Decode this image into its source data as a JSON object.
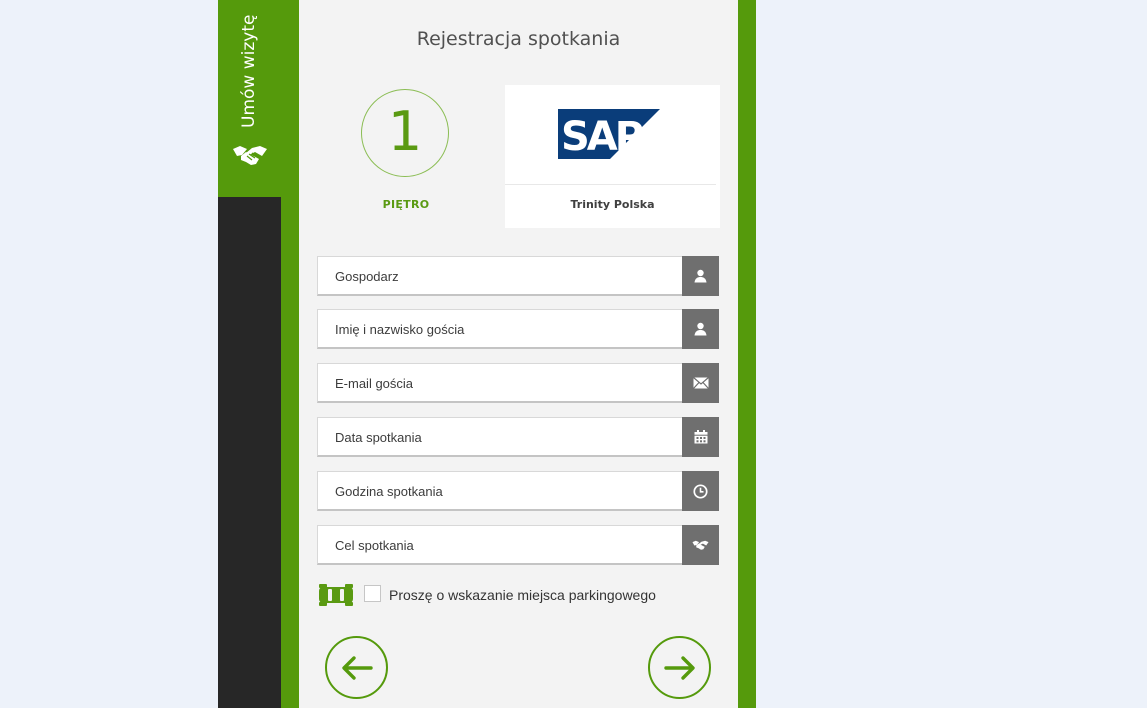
{
  "sidebar": {
    "tab_label": "Umów wizytę",
    "icon": "handshake-icon"
  },
  "form": {
    "title": "Rejestracja spotkania",
    "floor": {
      "number": "1",
      "label": "PIĘTRO"
    },
    "company": {
      "logo_text": "SAP",
      "name": "Trinity Polska"
    },
    "fields": {
      "host": {
        "placeholder": "Gospodarz",
        "icon": "user-icon"
      },
      "guest_name": {
        "placeholder": "Imię i nazwisko gościa",
        "icon": "user-icon"
      },
      "guest_email": {
        "placeholder": "E-mail gościa",
        "icon": "envelope-icon"
      },
      "date": {
        "placeholder": "Data spotkania",
        "icon": "calendar-icon"
      },
      "time": {
        "placeholder": "Godzina spotkania",
        "icon": "clock-icon"
      },
      "purpose": {
        "placeholder": "Cel spotkania",
        "icon": "handshake-icon"
      }
    },
    "parking": {
      "label": "Proszę o wskazanie miejsca parkingowego",
      "checked": false
    },
    "nav": {
      "back_icon": "arrow-left-icon",
      "next_icon": "arrow-right-icon"
    }
  },
  "colors": {
    "brand_green": "#559a0c",
    "dark": "#272727",
    "panel": "#f3f3f3",
    "icon_bg": "#6f6f6f",
    "sap_blue": "#0a3d7a"
  }
}
